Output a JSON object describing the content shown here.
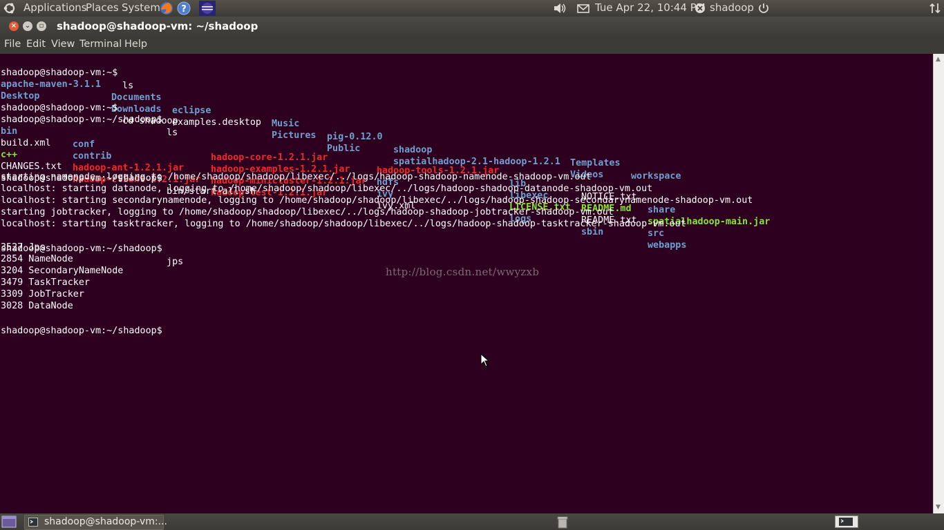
{
  "top_panel": {
    "applications": "Applications",
    "places": "Places",
    "system": "System",
    "datetime": "Tue Apr 22, 10:44 PM",
    "user": "shadoop"
  },
  "window": {
    "title": "shadoop@shadoop-vm: ~/shadoop"
  },
  "menu": {
    "file": "File",
    "edit": "Edit",
    "view": "View",
    "terminal": "Terminal",
    "help": "Help"
  },
  "terminal": {
    "prompt_home": "shadoop@shadoop-vm:~$",
    "prompt_shadoop": "shadoop@shadoop-vm:~/shadoop$",
    "cmd_ls": " ls",
    "cmd_cd": " cd shadoop",
    "cmd_start": " bin/start-all.sh",
    "cmd_jps": " jps",
    "home_listing": {
      "apache_maven": "apache-maven-3.1.1",
      "documents": "Documents",
      "eclipse": "eclipse",
      "music": "Music",
      "pig": "pig-0.12.0",
      "shadoop": "shadoop",
      "templates": "Templates",
      "workspace": "workspace",
      "desktop": "Desktop",
      "downloads": "Downloads",
      "examples_desktop": "examples.desktop",
      "pictures": "Pictures",
      "public": "Public",
      "spatialhadoop": "spatialhadoop-2.1-hadoop-1.2.1",
      "videos": "Videos"
    },
    "shadoop_listing": {
      "bin": "bin",
      "conf": "conf",
      "hadoop_core": "hadoop-core-1.2.1.jar",
      "hadoop_tools": "hadoop-tools-1.2.1.jar",
      "lib": "lib",
      "notice": "NOTICE.txt",
      "share": "share",
      "build_xml": "build.xml",
      "contrib": "contrib",
      "hadoop_examples": "hadoop-examples-1.2.1.jar",
      "hdfs": "hdfs",
      "libexec": "libexec",
      "readme_md": "README.md",
      "spatial_main": "spatialhadoop-main.jar",
      "cpp": "c++",
      "hadoop_ant": "hadoop-ant-1.2.1.jar",
      "hadoop_minicluster": "hadoop-minicluster-1.2.1.jar",
      "ivy": "ivy",
      "license": "LICENSE.txt",
      "readme_txt": "README.txt",
      "src": "src",
      "changes": "CHANGES.txt",
      "hadoop_client": "hadoop-client-1.2.1.jar",
      "hadoop_test": "hadoop-test-1.2.1.jar",
      "ivy_xml": "ivy.xml",
      "logs": "logs",
      "sbin": "sbin",
      "webapps": "webapps"
    },
    "start_output": [
      "starting namenode, logging to /home/shadoop/shadoop/libexec/../logs/hadoop-shadoop-namenode-shadoop-vm.out",
      "localhost: starting datanode, logging to /home/shadoop/shadoop/libexec/../logs/hadoop-shadoop-datanode-shadoop-vm.out",
      "localhost: starting secondarynamenode, logging to /home/shadoop/shadoop/libexec/../logs/hadoop-shadoop-secondarynamenode-shadoop-vm.out",
      "starting jobtracker, logging to /home/shadoop/shadoop/libexec/../logs/hadoop-shadoop-jobtracker-shadoop-vm.out",
      "localhost: starting tasktracker, logging to /home/shadoop/shadoop/libexec/../logs/hadoop-shadoop-tasktracker-shadoop-vm.out"
    ],
    "jps_output": [
      "3527 Jps",
      "2854 NameNode",
      "3204 SecondaryNameNode",
      "3479 TaskTracker",
      "3309 JobTracker",
      "3028 DataNode"
    ],
    "watermark": "http://blog.csdn.net/wwyzxb"
  },
  "taskbar": {
    "task_label": "shadoop@shadoop-vm:..."
  },
  "colors": {
    "terminal_bg": "#2c001e",
    "dir_blue": "#729fcf",
    "archive_red": "#ef2929",
    "exec_green": "#8ae234"
  }
}
